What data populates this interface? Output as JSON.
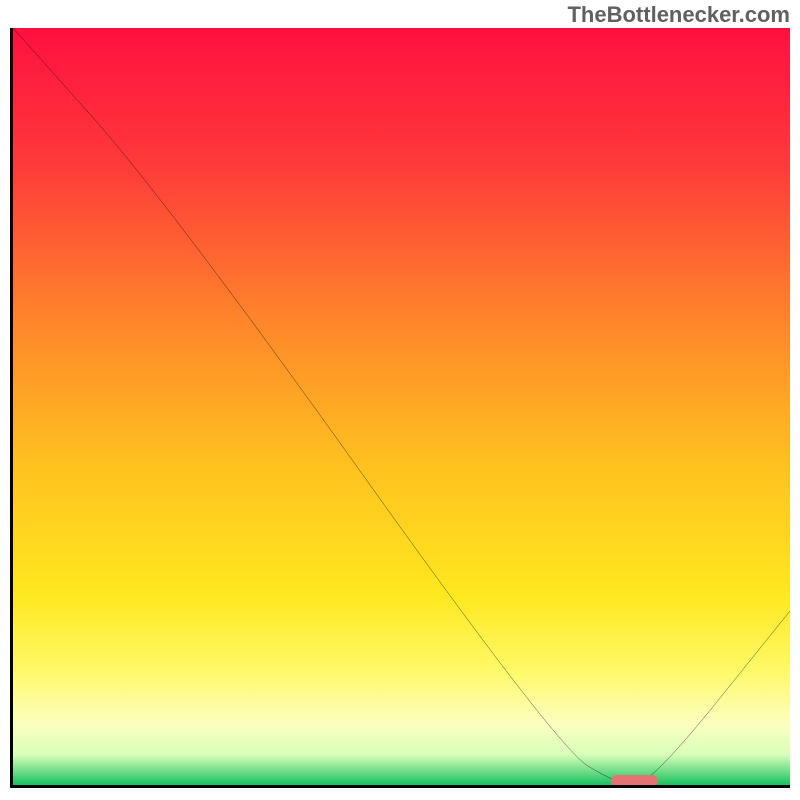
{
  "watermark": "TheBottlenecker.com",
  "chart_data": {
    "type": "line",
    "title": "",
    "xlabel": "",
    "ylabel": "",
    "xlim": [
      0,
      100
    ],
    "ylim": [
      0,
      100
    ],
    "series": [
      {
        "name": "curve",
        "x": [
          0,
          20,
          70,
          78,
          82,
          100
        ],
        "values": [
          100,
          77,
          5,
          0,
          0,
          23
        ]
      }
    ],
    "marker": {
      "x_start": 77,
      "x_end": 83,
      "y": 0
    },
    "gradient_stops": [
      {
        "pct": 0,
        "color": "#ff1040"
      },
      {
        "pct": 18,
        "color": "#ff3a3a"
      },
      {
        "pct": 40,
        "color": "#ff8a2a"
      },
      {
        "pct": 58,
        "color": "#ffc21f"
      },
      {
        "pct": 75,
        "color": "#ffe81f"
      },
      {
        "pct": 85,
        "color": "#fff96a"
      },
      {
        "pct": 92,
        "color": "#fbffc0"
      },
      {
        "pct": 96,
        "color": "#d8ffb8"
      },
      {
        "pct": 100,
        "color": "#18c060"
      }
    ]
  }
}
